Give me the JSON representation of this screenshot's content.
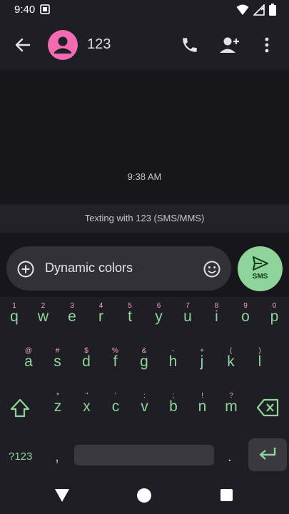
{
  "status_bar": {
    "time": "9:40",
    "icons": [
      "gallery-icon",
      "wifi-icon",
      "signal-icon",
      "battery-icon"
    ]
  },
  "header": {
    "contact_name": "123",
    "icons": [
      "back-arrow-icon",
      "avatar-person-icon",
      "phone-icon",
      "add-person-icon",
      "more-vert-icon"
    ],
    "avatar_color": "#f26bb0"
  },
  "conversation": {
    "timestamp": "9:38 AM",
    "texting_info": "Texting with 123 (SMS/MMS)"
  },
  "compose": {
    "text": "Dynamic colors",
    "send_label": "SMS",
    "accent_color": "#8fd49b"
  },
  "keyboard": {
    "row1": [
      {
        "key": "q",
        "hint": "1"
      },
      {
        "key": "w",
        "hint": "2"
      },
      {
        "key": "e",
        "hint": "3"
      },
      {
        "key": "r",
        "hint": "4"
      },
      {
        "key": "t",
        "hint": "5"
      },
      {
        "key": "y",
        "hint": "6"
      },
      {
        "key": "u",
        "hint": "7"
      },
      {
        "key": "i",
        "hint": "8"
      },
      {
        "key": "o",
        "hint": "9"
      },
      {
        "key": "p",
        "hint": "0"
      }
    ],
    "row2": [
      {
        "key": "a",
        "hint": "@"
      },
      {
        "key": "s",
        "hint": "#"
      },
      {
        "key": "d",
        "hint": "$"
      },
      {
        "key": "f",
        "hint": "%"
      },
      {
        "key": "g",
        "hint": "&"
      },
      {
        "key": "h",
        "hint": "-"
      },
      {
        "key": "j",
        "hint": "+"
      },
      {
        "key": "k",
        "hint": "("
      },
      {
        "key": "l",
        "hint": ")"
      }
    ],
    "row3": [
      {
        "key": "z",
        "hint": "*"
      },
      {
        "key": "x",
        "hint": "\""
      },
      {
        "key": "c",
        "hint": "'"
      },
      {
        "key": "v",
        "hint": ":"
      },
      {
        "key": "b",
        "hint": ";"
      },
      {
        "key": "n",
        "hint": "!"
      },
      {
        "key": "m",
        "hint": "?"
      }
    ],
    "symbols_label": "?123",
    "comma": ",",
    "period": ".",
    "hint_color": "#f3a7c7"
  },
  "nav_bar": {
    "icons": [
      "nav-back-icon",
      "nav-home-icon",
      "nav-recents-icon"
    ]
  }
}
